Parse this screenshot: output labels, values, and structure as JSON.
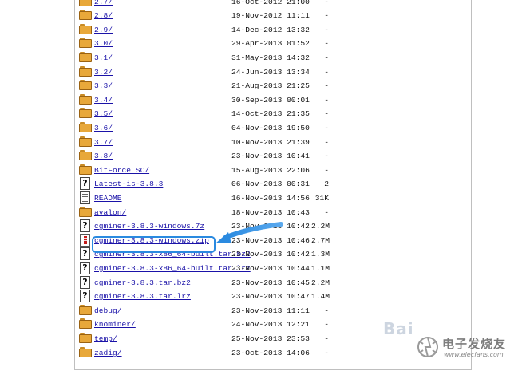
{
  "listing": {
    "entries": [
      {
        "name": "2.7/",
        "date": "16-Oct-2012 21:00",
        "size": "-",
        "type": "folder"
      },
      {
        "name": "2.8/",
        "date": "19-Nov-2012 11:11",
        "size": "-",
        "type": "folder"
      },
      {
        "name": "2.9/",
        "date": "14-Dec-2012 13:32",
        "size": "-",
        "type": "folder"
      },
      {
        "name": "3.0/",
        "date": "29-Apr-2013 01:52",
        "size": "-",
        "type": "folder"
      },
      {
        "name": "3.1/",
        "date": "31-May-2013 14:32",
        "size": "-",
        "type": "folder"
      },
      {
        "name": "3.2/",
        "date": "24-Jun-2013 13:34",
        "size": "-",
        "type": "folder"
      },
      {
        "name": "3.3/",
        "date": "21-Aug-2013 21:25",
        "size": "-",
        "type": "folder"
      },
      {
        "name": "3.4/",
        "date": "30-Sep-2013 00:01",
        "size": "-",
        "type": "folder"
      },
      {
        "name": "3.5/",
        "date": "14-Oct-2013 21:35",
        "size": "-",
        "type": "folder"
      },
      {
        "name": "3.6/",
        "date": "04-Nov-2013 19:50",
        "size": "-",
        "type": "folder"
      },
      {
        "name": "3.7/",
        "date": "10-Nov-2013 21:39",
        "size": "-",
        "type": "folder"
      },
      {
        "name": "3.8/",
        "date": "23-Nov-2013 10:41",
        "size": "-",
        "type": "folder"
      },
      {
        "name": "BitForce SC/",
        "date": "15-Aug-2013 22:06",
        "size": "-",
        "type": "folder"
      },
      {
        "name": "Latest-is-3.8.3",
        "date": "06-Nov-2013 00:31",
        "size": "2",
        "type": "unknown"
      },
      {
        "name": "README",
        "date": "16-Nov-2013 14:56",
        "size": "31K",
        "type": "text"
      },
      {
        "name": "avalon/",
        "date": "18-Nov-2013 10:43",
        "size": "-",
        "type": "folder"
      },
      {
        "name": "cgminer-3.8.3-windows.7z",
        "date": "23-Nov-2013 10:42",
        "size": "2.2M",
        "type": "unknown"
      },
      {
        "name": "cgminer-3.8.3-windows.zip",
        "date": "23-Nov-2013 10:46",
        "size": "2.7M",
        "type": "zip"
      },
      {
        "name": "cgminer-3.8.3-x86_64-built.tar.bz2",
        "date": "23-Nov-2013 10:42",
        "size": "1.3M",
        "type": "unknown"
      },
      {
        "name": "cgminer-3.8.3-x86_64-built.tar.lrz",
        "date": "23-Nov-2013 10:44",
        "size": "1.1M",
        "type": "unknown"
      },
      {
        "name": "cgminer-3.8.3.tar.bz2",
        "date": "23-Nov-2013 10:45",
        "size": "2.2M",
        "type": "unknown"
      },
      {
        "name": "cgminer-3.8.3.tar.lrz",
        "date": "23-Nov-2013 10:47",
        "size": "1.4M",
        "type": "unknown"
      },
      {
        "name": "debug/",
        "date": "23-Nov-2013 11:11",
        "size": "-",
        "type": "folder"
      },
      {
        "name": "knominer/",
        "date": "24-Nov-2013 12:21",
        "size": "-",
        "type": "folder"
      },
      {
        "name": "temp/",
        "date": "25-Nov-2013 23:53",
        "size": "-",
        "type": "folder"
      },
      {
        "name": "zadig/",
        "date": "23-Oct-2013 14:06",
        "size": "-",
        "type": "folder"
      }
    ]
  },
  "annotation": {
    "highlight_color": "#2a8ae0",
    "arrow_color": "#2a8ae0"
  },
  "watermark": {
    "baidu": "Bai",
    "brand_cn": "电子发烧友",
    "url": "www.elecfans.com"
  }
}
